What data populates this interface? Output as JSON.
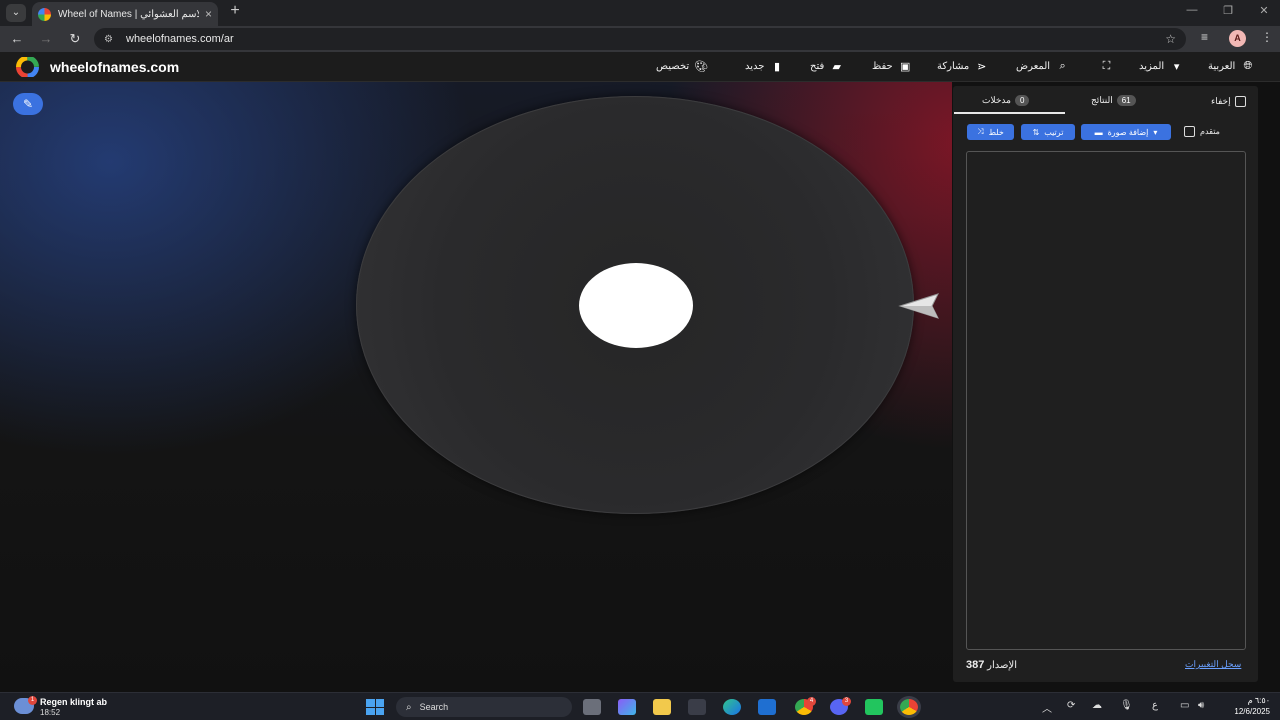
{
  "browser": {
    "tab_title": "Wheel of Names | عجلة الاسم العشوائي",
    "new_tab": "+",
    "address": "wheelofnames.com/ar",
    "profile_initial": "A"
  },
  "site": {
    "logo_text": "wheelofnames.com",
    "menu": {
      "customize": "تخصيص",
      "new": "جديد",
      "open": "فتح",
      "save": "حفظ",
      "share": "مشاركة",
      "gallery": "المعرض",
      "more": "المزيد",
      "language": "العربية"
    }
  },
  "panel": {
    "hide_label": "إخفاء",
    "results_tab": {
      "label": "النتائج",
      "count": "61"
    },
    "entries_tab": {
      "label": "مدخلات",
      "count": "0"
    },
    "shuffle_label": "خلط",
    "sort_label": "ترتيب",
    "add_image_label": "إضافة صورة",
    "advanced_label": "متقدم",
    "version_label": "الإصدار",
    "version_number": "387",
    "changelog_label": "سجل التغييرات"
  },
  "taskbar": {
    "weather_title": "Regen klingt ab",
    "weather_time": "18:52",
    "weather_badge": "1",
    "search_label": "Search",
    "discord_badge": "3",
    "chrome_badge": "4",
    "input_lang": "ع",
    "clock_time": "٦:٥٠ م",
    "clock_date": "12/6/2025"
  },
  "colors": {
    "accent_blue": "#3b72e0",
    "panel_bg": "#1f1f1f",
    "header_bg": "#1c1c1c"
  }
}
